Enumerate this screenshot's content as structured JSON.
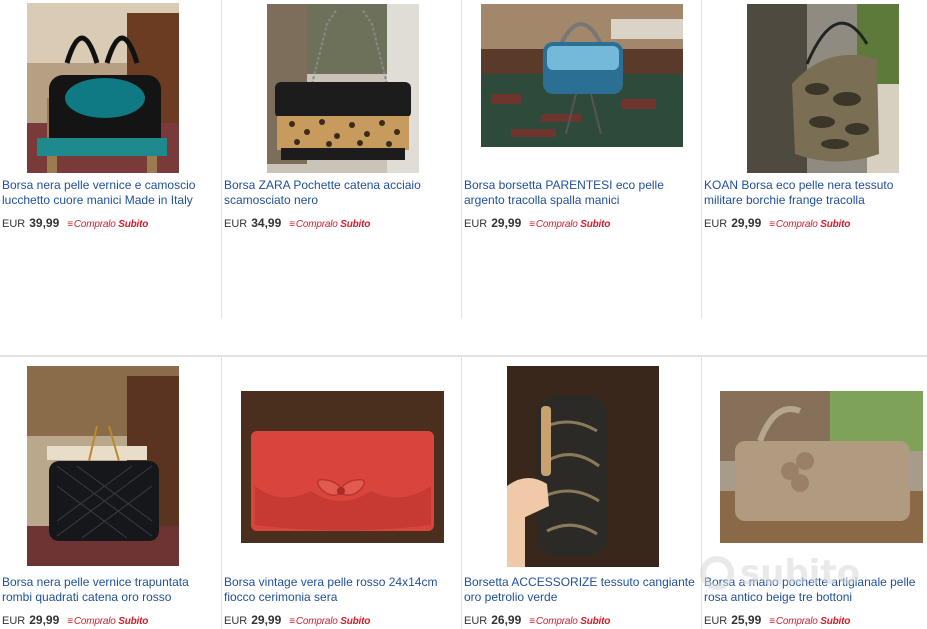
{
  "currency": "EUR",
  "buy_now": {
    "prefix": "Compralo",
    "emph": "Subito"
  },
  "watermark": "subito",
  "row1": [
    {
      "title": "Borsa nera pelle vernice e camoscio lucchetto cuore manici Made in Italy",
      "price": "39,99"
    },
    {
      "title": "Borsa ZARA Pochette catena acciaio scamosciato nero",
      "price": "34,99"
    },
    {
      "title": "Borsa borsetta PARENTESI eco pelle argento tracolla spalla manici",
      "price": "29,99"
    },
    {
      "title": "KOAN Borsa eco pelle nera tessuto militare borchie frange tracolla",
      "price": "29,99"
    }
  ],
  "row2": [
    {
      "title": "Borsa nera pelle vernice trapuntata rombi quadrati catena oro rosso",
      "price": "29,99"
    },
    {
      "title": "Borsa vintage vera pelle rosso 24x14cm fiocco cerimonia sera",
      "price": "29,99"
    },
    {
      "title": "Borsetta ACCESSORIZE tessuto cangiante oro petrolio verde",
      "price": "26,99"
    },
    {
      "title": "Borsa a mano pochette artigianale pelle rosa antico beige tre bottoni",
      "price": "25,99"
    }
  ]
}
